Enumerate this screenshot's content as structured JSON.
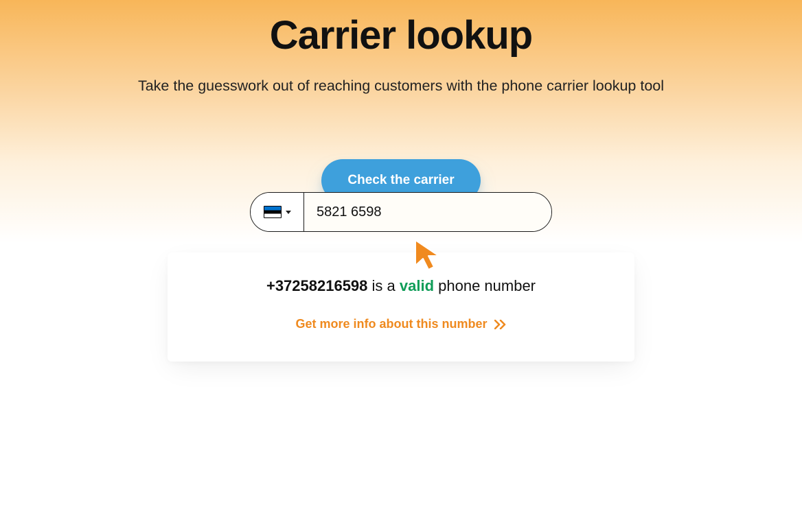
{
  "header": {
    "title": "Carrier lookup",
    "subtitle": "Take the guesswork out of reaching customers with the phone carrier lookup tool"
  },
  "input": {
    "country_flag": "estonia",
    "phone_value": "5821 6598",
    "placeholder": ""
  },
  "button": {
    "check_label": "Check the carrier"
  },
  "result": {
    "phone_number": "+37258216598",
    "middle_text": " is a ",
    "valid_word": "valid",
    "trailing_text": " phone number",
    "more_info_label": "Get more info about this number"
  },
  "colors": {
    "accent_blue": "#3ea0dc",
    "accent_orange": "#ef8a1f",
    "valid_green": "#0f9d58"
  }
}
